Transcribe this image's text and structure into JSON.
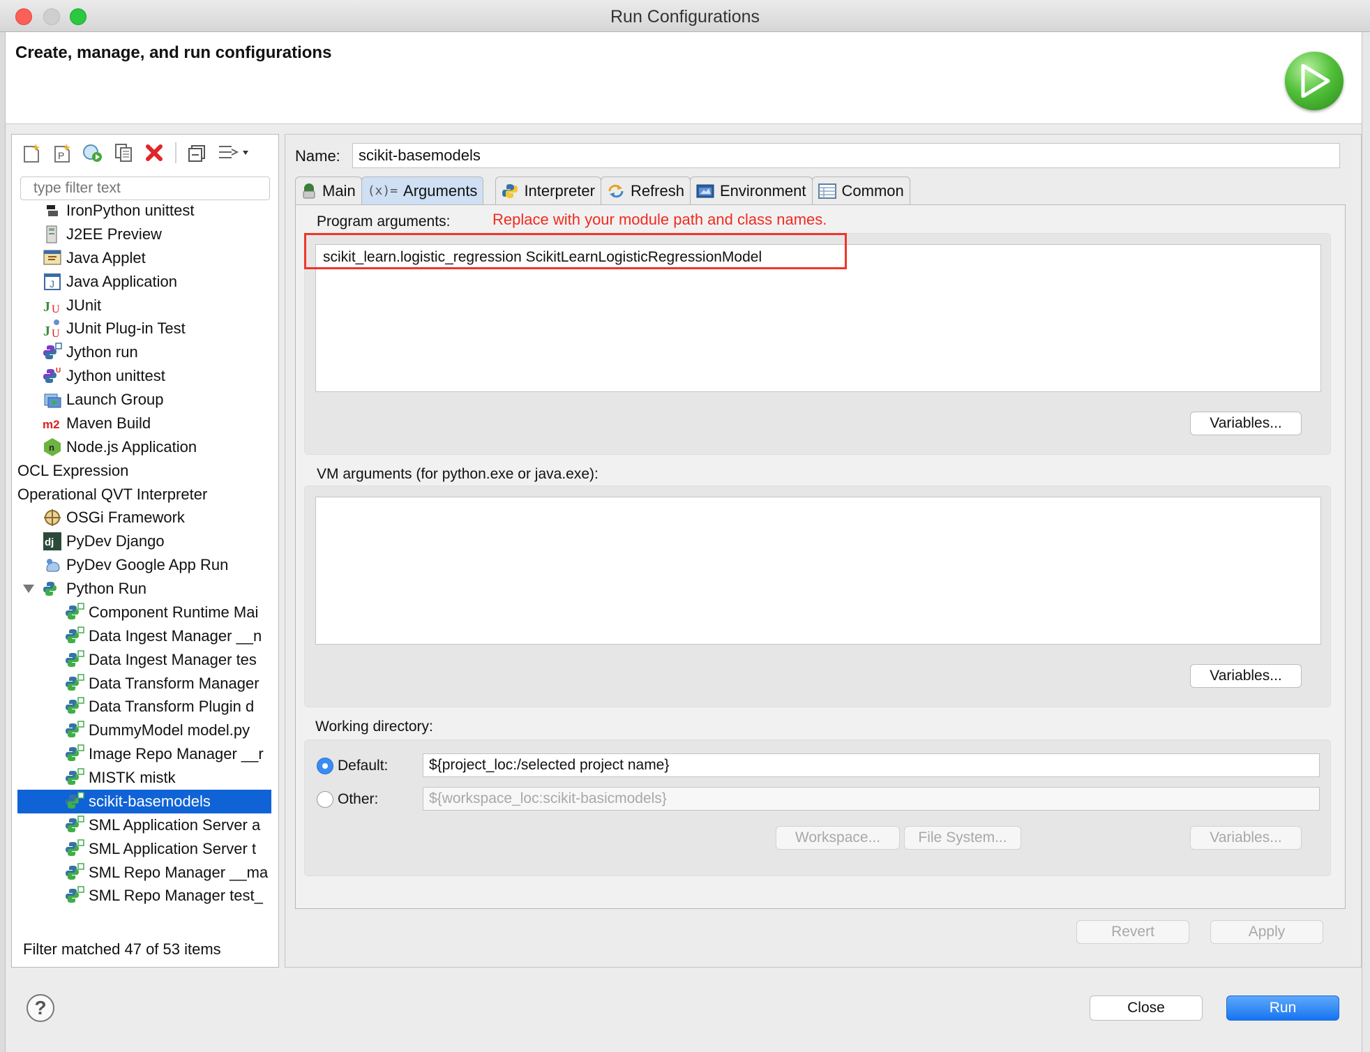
{
  "window": {
    "title": "Run Configurations"
  },
  "header": {
    "title": "Create, manage, and run configurations"
  },
  "left": {
    "filter_placeholder": "type filter text",
    "tree": [
      {
        "label": "IronPython unittest",
        "icon": "python-unittest-icon",
        "indent": 0
      },
      {
        "label": "J2EE Preview",
        "icon": "j2ee-preview-icon",
        "indent": 0
      },
      {
        "label": "Java Applet",
        "icon": "java-applet-icon",
        "indent": 0
      },
      {
        "label": "Java Application",
        "icon": "java-application-icon",
        "indent": 0
      },
      {
        "label": "JUnit",
        "icon": "junit-icon",
        "indent": 0
      },
      {
        "label": "JUnit Plug-in Test",
        "icon": "junit-plugin-icon",
        "indent": 0
      },
      {
        "label": "Jython run",
        "icon": "jython-run-icon",
        "indent": 0
      },
      {
        "label": "Jython unittest",
        "icon": "jython-unittest-icon",
        "indent": 0
      },
      {
        "label": "Launch Group",
        "icon": "launch-group-icon",
        "indent": 0
      },
      {
        "label": "Maven Build",
        "icon": "maven-icon",
        "indent": 0
      },
      {
        "label": "Node.js Application",
        "icon": "nodejs-icon",
        "indent": 0
      },
      {
        "label": "OCL Expression",
        "icon": "",
        "indent": 0
      },
      {
        "label": "Operational QVT Interpreter",
        "icon": "",
        "indent": 0
      },
      {
        "label": "OSGi Framework",
        "icon": "osgi-icon",
        "indent": 0
      },
      {
        "label": "PyDev Django",
        "icon": "django-icon",
        "indent": 0
      },
      {
        "label": "PyDev Google App Run",
        "icon": "google-app-icon",
        "indent": 0
      },
      {
        "label": "Python Run",
        "icon": "python-run-icon",
        "indent": 0,
        "expanded": true
      },
      {
        "label": "Component Runtime Mai",
        "icon": "python-config-icon",
        "indent": 1
      },
      {
        "label": "Data Ingest Manager __n",
        "icon": "python-config-icon",
        "indent": 1
      },
      {
        "label": "Data Ingest Manager tes",
        "icon": "python-config-icon",
        "indent": 1
      },
      {
        "label": "Data Transform Manager",
        "icon": "python-config-icon",
        "indent": 1
      },
      {
        "label": "Data Transform Plugin d",
        "icon": "python-config-icon",
        "indent": 1
      },
      {
        "label": "DummyModel model.py",
        "icon": "python-config-icon",
        "indent": 1
      },
      {
        "label": "Image Repo Manager __r",
        "icon": "python-config-icon",
        "indent": 1
      },
      {
        "label": "MISTK mistk",
        "icon": "python-config-icon",
        "indent": 1
      },
      {
        "label": "scikit-basemodels",
        "icon": "python-config-icon",
        "indent": 1,
        "selected": true
      },
      {
        "label": "SML Application Server a",
        "icon": "python-config-icon",
        "indent": 1
      },
      {
        "label": "SML Application Server t",
        "icon": "python-config-icon",
        "indent": 1
      },
      {
        "label": "SML Repo Manager __ma",
        "icon": "python-config-icon",
        "indent": 1
      },
      {
        "label": "SML Repo Manager test_",
        "icon": "python-config-icon",
        "indent": 1
      },
      {
        "label": "SML Repo Manager test_",
        "icon": "python-config-icon",
        "indent": 1
      }
    ],
    "status": "Filter matched 47 of 53 items"
  },
  "config": {
    "name_label": "Name:",
    "name_value": "scikit-basemodels",
    "tabs": [
      {
        "label": "Main",
        "icon": "main-tab-icon"
      },
      {
        "label": "Arguments",
        "icon": "arguments-tab-icon",
        "active": true
      },
      {
        "label": "Interpreter",
        "icon": "interpreter-tab-icon"
      },
      {
        "label": "Refresh",
        "icon": "refresh-tab-icon"
      },
      {
        "label": "Environment",
        "icon": "environment-tab-icon"
      },
      {
        "label": "Common",
        "icon": "common-tab-icon"
      }
    ],
    "program_args_label": "Program arguments:",
    "program_args_value": "scikit_learn.logistic_regression ScikitLearnLogisticRegressionModel",
    "annotation": "Replace with your module path and class names.",
    "variables_label": "Variables...",
    "vm_args_label": "VM arguments (for python.exe or java.exe):",
    "vm_args_value": "",
    "working_dir_label": "Working directory:",
    "default_label": "Default:",
    "default_value": "${project_loc:/selected project name}",
    "other_label": "Other:",
    "other_value": "${workspace_loc:scikit-basicmodels}",
    "workspace_btn": "Workspace...",
    "filesystem_btn": "File System...",
    "revert_btn": "Revert",
    "apply_btn": "Apply"
  },
  "footer": {
    "close": "Close",
    "run": "Run",
    "help": "?"
  },
  "colors": {
    "accent": "#1774f0",
    "selection": "#0f63d6",
    "annotation": "#f02b1f"
  }
}
